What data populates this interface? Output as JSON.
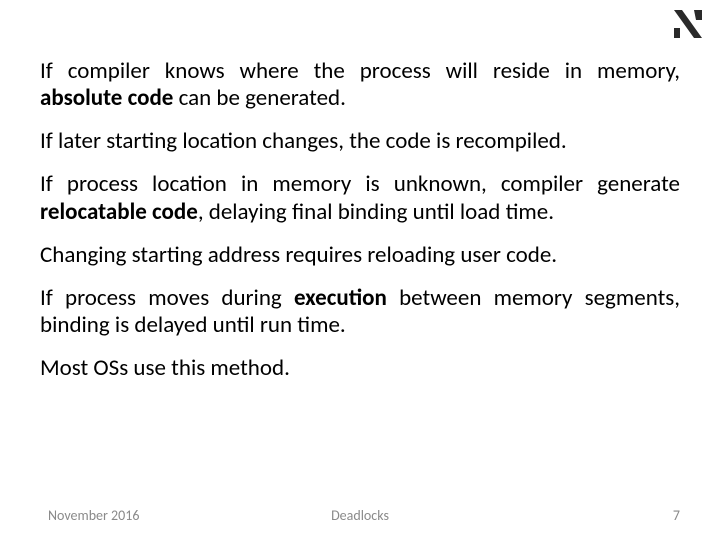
{
  "logo": {
    "name": "institution-logo"
  },
  "paragraphs": {
    "p1_a": "If compiler knows where the process will reside in memory, ",
    "p1_bold": "absolute code",
    "p1_b": " can be generated.",
    "p2": "If later starting location changes, the code is recompiled.",
    "p3_a": "If process location in memory is unknown, compiler generate ",
    "p3_bold": "relocatable code",
    "p3_b": ", delaying final binding until load time.",
    "p4": "Changing starting address requires reloading user code.",
    "p5_a": "If process moves during ",
    "p5_bold": "execution",
    "p5_b": " between memory segments, binding is delayed until run time.",
    "p6": "Most OSs use this method."
  },
  "footer": {
    "date": "November 2016",
    "title": "Deadlocks",
    "page": "7"
  }
}
